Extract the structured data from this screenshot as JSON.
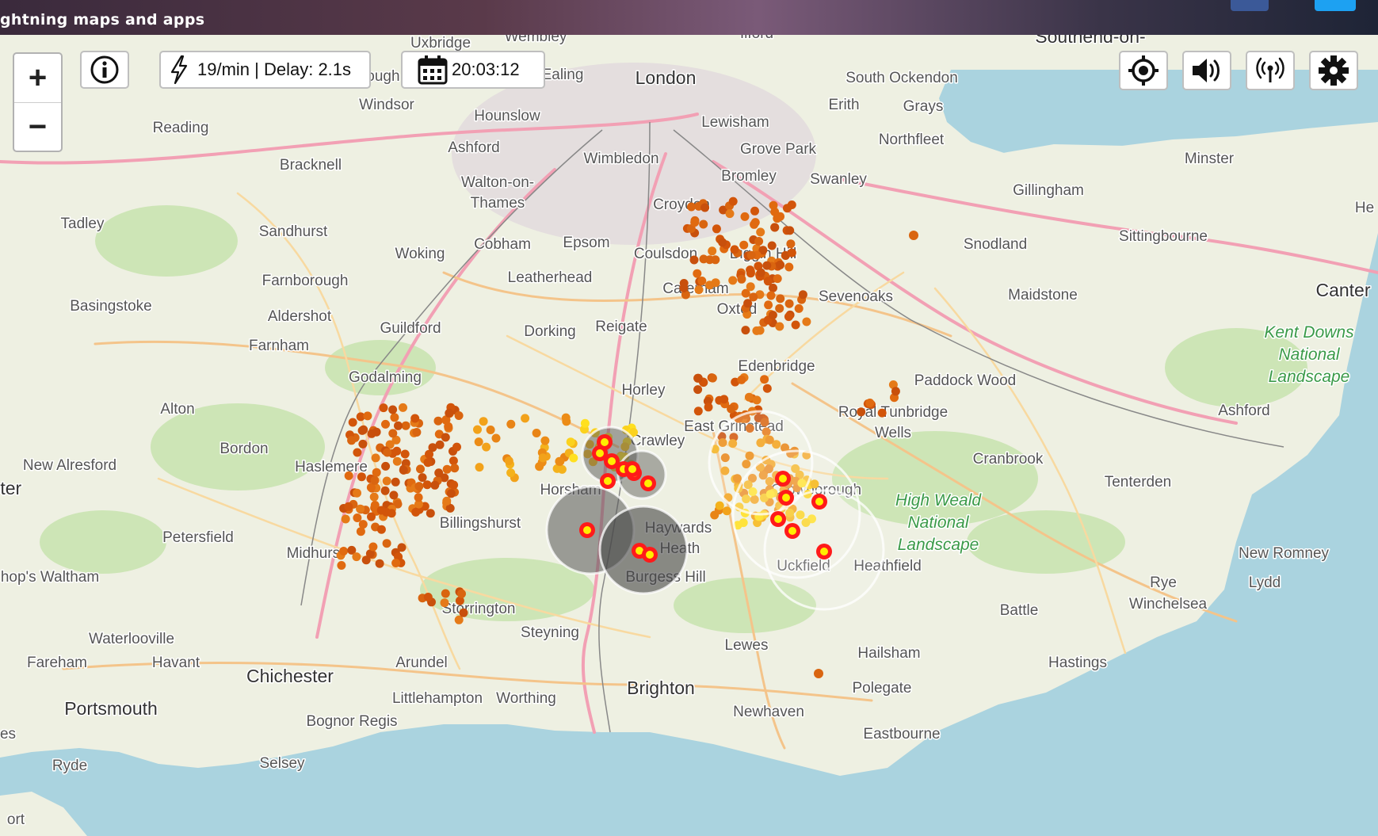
{
  "header": {
    "tagline": "ghtning maps and apps"
  },
  "controls": {
    "zoom_in": "+",
    "zoom_out": "−",
    "rate_text": "19/min | Delay: 2.1s",
    "time_text": "20:03:12"
  },
  "colors": {
    "sea": "#aad3df",
    "land": "#eef0e2",
    "recent_strike": "#ff1a1a",
    "strike_core": "#ffee00",
    "older_strike": "#d96510"
  },
  "places": [
    {
      "name": "Southend-on-",
      "cls": "big"
    },
    {
      "name": "Wembley",
      "cls": ""
    },
    {
      "name": "Uxbridge",
      "cls": ""
    },
    {
      "name": "Ilford",
      "cls": ""
    },
    {
      "name": "London",
      "cls": "big"
    },
    {
      "name": "Slough",
      "cls": ""
    },
    {
      "name": "Ealing",
      "cls": ""
    },
    {
      "name": "South Ockendon",
      "cls": ""
    },
    {
      "name": "Windsor",
      "cls": ""
    },
    {
      "name": "Erith",
      "cls": ""
    },
    {
      "name": "Grays",
      "cls": ""
    },
    {
      "name": "Hounslow",
      "cls": ""
    },
    {
      "name": "Lewisham",
      "cls": ""
    },
    {
      "name": "Reading",
      "cls": ""
    },
    {
      "name": "Northfleet",
      "cls": ""
    },
    {
      "name": "Ashford",
      "cls": ""
    },
    {
      "name": "Grove Park",
      "cls": ""
    },
    {
      "name": "Wimbledon",
      "cls": ""
    },
    {
      "name": "Minster",
      "cls": ""
    },
    {
      "name": "Bracknell",
      "cls": ""
    },
    {
      "name": "Bromley",
      "cls": ""
    },
    {
      "name": "Swanley",
      "cls": ""
    },
    {
      "name": "Walton-on-",
      "cls": ""
    },
    {
      "name": "Thames",
      "cls": ""
    },
    {
      "name": "Gillingham",
      "cls": ""
    },
    {
      "name": "Croydon",
      "cls": ""
    },
    {
      "name": "Tadley",
      "cls": ""
    },
    {
      "name": "He",
      "cls": ""
    },
    {
      "name": "Sandhurst",
      "cls": ""
    },
    {
      "name": "Sittingbourne",
      "cls": ""
    },
    {
      "name": "Epsom",
      "cls": ""
    },
    {
      "name": "Cobham",
      "cls": ""
    },
    {
      "name": "Snodland",
      "cls": ""
    },
    {
      "name": "Woking",
      "cls": ""
    },
    {
      "name": "Coulsdon",
      "cls": ""
    },
    {
      "name": "Biggin Hill",
      "cls": ""
    },
    {
      "name": "Farnborough",
      "cls": ""
    },
    {
      "name": "Leatherhead",
      "cls": ""
    },
    {
      "name": "Caterham",
      "cls": ""
    },
    {
      "name": "Maidstone",
      "cls": ""
    },
    {
      "name": "Sevenoaks",
      "cls": ""
    },
    {
      "name": "Canter",
      "cls": "big"
    },
    {
      "name": "Basingstoke",
      "cls": ""
    },
    {
      "name": "Oxted",
      "cls": ""
    },
    {
      "name": "Aldershot",
      "cls": ""
    },
    {
      "name": "Guildford",
      "cls": ""
    },
    {
      "name": "Reigate",
      "cls": ""
    },
    {
      "name": "Dorking",
      "cls": ""
    },
    {
      "name": "Farnham",
      "cls": ""
    },
    {
      "name": "Edenbridge",
      "cls": ""
    },
    {
      "name": "Godalming",
      "cls": ""
    },
    {
      "name": "Paddock Wood",
      "cls": ""
    },
    {
      "name": "Horley",
      "cls": ""
    },
    {
      "name": "Alton",
      "cls": ""
    },
    {
      "name": "Royal Tunbridge",
      "cls": ""
    },
    {
      "name": "Wells",
      "cls": ""
    },
    {
      "name": "Ashford",
      "cls": ""
    },
    {
      "name": "East Grinstead",
      "cls": ""
    },
    {
      "name": "Crawley",
      "cls": ""
    },
    {
      "name": "Bordon",
      "cls": ""
    },
    {
      "name": "Cranbrook",
      "cls": ""
    },
    {
      "name": "New Alresford",
      "cls": ""
    },
    {
      "name": "Haslemere",
      "cls": ""
    },
    {
      "name": "Tenterden",
      "cls": ""
    },
    {
      "name": "ster",
      "cls": "big"
    },
    {
      "name": "Horsham",
      "cls": ""
    },
    {
      "name": "Crowborough",
      "cls": ""
    },
    {
      "name": "Billingshurst",
      "cls": ""
    },
    {
      "name": "Haywards",
      "cls": ""
    },
    {
      "name": "Heath",
      "cls": ""
    },
    {
      "name": "Petersfield",
      "cls": ""
    },
    {
      "name": "Midhurst",
      "cls": ""
    },
    {
      "name": "Uckfield",
      "cls": ""
    },
    {
      "name": "Heathfield",
      "cls": ""
    },
    {
      "name": "New Romney",
      "cls": ""
    },
    {
      "name": "Burgess Hill",
      "cls": ""
    },
    {
      "name": "hop's Waltham",
      "cls": ""
    },
    {
      "name": "Rye",
      "cls": ""
    },
    {
      "name": "Lydd",
      "cls": ""
    },
    {
      "name": "Storrington",
      "cls": ""
    },
    {
      "name": "Battle",
      "cls": ""
    },
    {
      "name": "Winchelsea",
      "cls": ""
    },
    {
      "name": "Steyning",
      "cls": ""
    },
    {
      "name": "Waterlooville",
      "cls": ""
    },
    {
      "name": "Lewes",
      "cls": ""
    },
    {
      "name": "Hailsham",
      "cls": ""
    },
    {
      "name": "Fareham",
      "cls": ""
    },
    {
      "name": "Havant",
      "cls": ""
    },
    {
      "name": "Arundel",
      "cls": ""
    },
    {
      "name": "Hastings",
      "cls": ""
    },
    {
      "name": "Chichester",
      "cls": "big"
    },
    {
      "name": "Polegate",
      "cls": ""
    },
    {
      "name": "Brighton",
      "cls": "big"
    },
    {
      "name": "Portsmouth",
      "cls": "big"
    },
    {
      "name": "Littlehampton",
      "cls": ""
    },
    {
      "name": "Worthing",
      "cls": ""
    },
    {
      "name": "Newhaven",
      "cls": ""
    },
    {
      "name": "Bognor Regis",
      "cls": ""
    },
    {
      "name": "Eastbourne",
      "cls": ""
    },
    {
      "name": "es",
      "cls": ""
    },
    {
      "name": "Ryde",
      "cls": ""
    },
    {
      "name": "Selsey",
      "cls": ""
    },
    {
      "name": "ort",
      "cls": ""
    }
  ],
  "parks": [
    {
      "lines": [
        "Kent Downs",
        "National",
        "Landscape"
      ]
    },
    {
      "lines": [
        "High Weald",
        "National",
        "Landscape"
      ]
    }
  ]
}
